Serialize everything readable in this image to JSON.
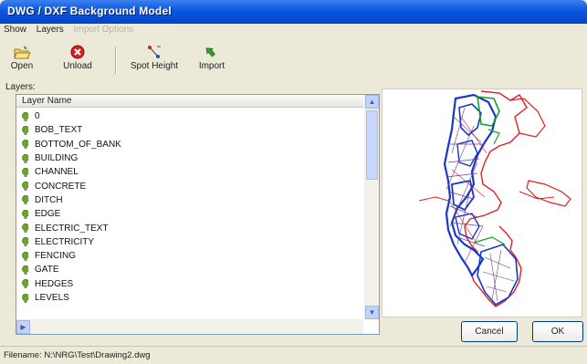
{
  "window": {
    "title": "DWG / DXF Background Model"
  },
  "menu": {
    "show": "Show",
    "layers": "Layers",
    "import_options": "Import Options"
  },
  "toolbar": {
    "open": "Open",
    "unload": "Unload",
    "spot_height": "Spot Height",
    "import": "Import"
  },
  "layers_label": "Layers:",
  "list_header": "Layer Name",
  "layers": [
    "0",
    "BOB_TEXT",
    "BOTTOM_OF_BANK",
    "BUILDING",
    "CHANNEL",
    "CONCRETE",
    "DITCH",
    "EDGE",
    "ELECTRIC_TEXT",
    "ELECTRICITY",
    "FENCING",
    "GATE",
    "HEDGES",
    "LEVELS"
  ],
  "buttons": {
    "cancel": "Cancel",
    "ok": "OK"
  },
  "status": {
    "filename": "Filename: N:\\NRG\\Test\\Drawing2.dwg"
  },
  "colors": {
    "title_bar": "#0a55e0",
    "window_bg": "#ece9d8",
    "bulb": "#6aa52c"
  }
}
